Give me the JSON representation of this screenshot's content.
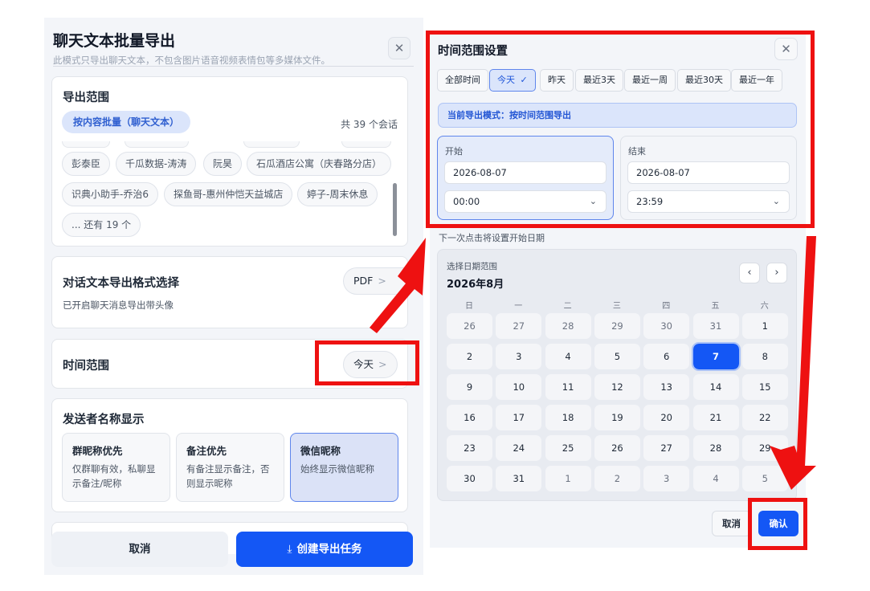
{
  "left_dialog": {
    "title": "聊天文本批量导出",
    "subtitle": "此模式只导出聊天文本，不包含图片语音视频表情包等多媒体文件。",
    "close_icon": "close-icon",
    "scope": {
      "heading": "导出范围",
      "mode_pill": "按内容批量（聊天文本）",
      "count": "共 39 个会话",
      "chips": [
        "彭泰臣",
        "千瓜数据-涛涛",
        "阮昊",
        "石瓜酒店公寓（庆春路分店）",
        "识典小助手-乔治6",
        "探鱼哥-惠州仲恺天益城店",
        "婷子-周末休息",
        "... 还有 19 个"
      ]
    },
    "format": {
      "heading": "对话文本导出格式选择",
      "description": "已开启聊天消息导出带头像",
      "button": "PDF",
      "arrow": ">"
    },
    "time": {
      "heading": "时间范围",
      "button": "今天",
      "arrow": ">"
    },
    "sender": {
      "heading": "发送者名称显示",
      "options": [
        {
          "title": "群昵称优先",
          "desc": "仅群聊有效，私聊显示备注/昵称"
        },
        {
          "title": "备注优先",
          "desc": "有备注显示备注，否则显示昵称"
        },
        {
          "title": "微信昵称",
          "desc": "始终显示微信昵称",
          "selected": true
        }
      ]
    },
    "footer": {
      "cancel": "取消",
      "create": "创建导出任务",
      "create_icon": "download-icon"
    }
  },
  "right_dialog": {
    "title": "时间范围设置",
    "close_icon": "close-icon",
    "presets": [
      "全部时间",
      "今天",
      "昨天",
      "最近3天",
      "最近一周",
      "最近30天",
      "最近一年"
    ],
    "active_preset": "今天",
    "check_icon": "✓",
    "mode_banner": "当前导出模式：按时间范围导出",
    "start": {
      "label": "开始",
      "date": "2026-08-07",
      "time": "00:00"
    },
    "end": {
      "label": "结束",
      "date": "2026-08-07",
      "time": "23:59"
    },
    "hint": "下一次点击将设置开始日期",
    "calendar": {
      "label": "选择日期范围",
      "month": "2026年8月",
      "prev": "‹",
      "next": "›",
      "weekdays": [
        "日",
        "一",
        "二",
        "三",
        "四",
        "五",
        "六"
      ],
      "weeks": [
        [
          "26",
          "27",
          "28",
          "29",
          "30",
          "31",
          "1"
        ],
        [
          "2",
          "3",
          "4",
          "5",
          "6",
          "7",
          "8"
        ],
        [
          "9",
          "10",
          "11",
          "12",
          "13",
          "14",
          "15"
        ],
        [
          "16",
          "17",
          "18",
          "19",
          "20",
          "21",
          "22"
        ],
        [
          "23",
          "24",
          "25",
          "26",
          "27",
          "28",
          "29"
        ],
        [
          "30",
          "31",
          "1",
          "2",
          "3",
          "4",
          "5"
        ]
      ],
      "selected": "7"
    },
    "footer": {
      "cancel": "取消",
      "confirm": "确认"
    }
  },
  "annotation_color": "#ee1111",
  "colors": {
    "accent": "#1457f5",
    "accent_soft": "#dbe5fb"
  }
}
